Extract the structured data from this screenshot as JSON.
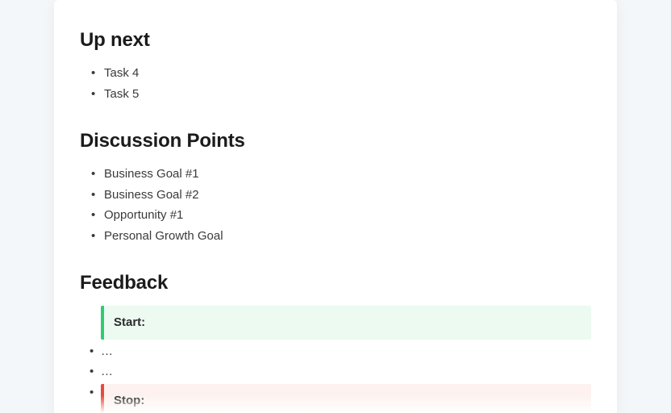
{
  "sections": {
    "upnext": {
      "heading": "Up next",
      "items": [
        "Task 4",
        "Task 5"
      ]
    },
    "discussion": {
      "heading": "Discussion Points",
      "items": [
        "Business Goal #1",
        "Business Goal #2",
        "Opportunity #1",
        "Personal Growth Goal"
      ]
    },
    "feedback": {
      "heading": "Feedback",
      "start_label": "Start:",
      "stop_label": "Stop:",
      "between": [
        "…",
        "…",
        ""
      ]
    }
  }
}
